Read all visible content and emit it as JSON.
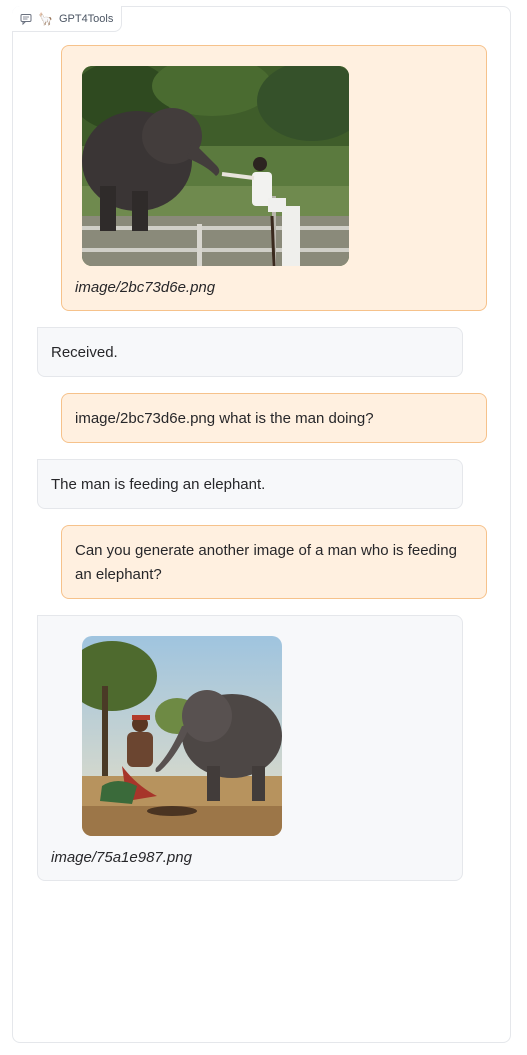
{
  "chatbot": {
    "label": "GPT4Tools",
    "label_icon": "chat-icon",
    "label_emoji": "🦙"
  },
  "messages": [
    {
      "role": "user",
      "type": "image",
      "caption": "image/2bc73d6e.png",
      "image_desc": "elephant-zoo-photo"
    },
    {
      "role": "bot",
      "type": "text",
      "text": "Received."
    },
    {
      "role": "user",
      "type": "text",
      "text": "image/2bc73d6e.png what is the man doing?"
    },
    {
      "role": "bot",
      "type": "text",
      "text": "The man is feeding an elephant."
    },
    {
      "role": "user",
      "type": "text",
      "text": "Can you generate another image of a man who is feeding an elephant?"
    },
    {
      "role": "bot",
      "type": "image",
      "caption": "image/75a1e987.png",
      "image_desc": "generated-man-feeding-elephant-painting"
    }
  ],
  "colors": {
    "user_bg": "#fff0e0",
    "user_border": "#f6c28b",
    "bot_bg": "#f7f8fa",
    "bot_border": "#e5e7eb"
  }
}
